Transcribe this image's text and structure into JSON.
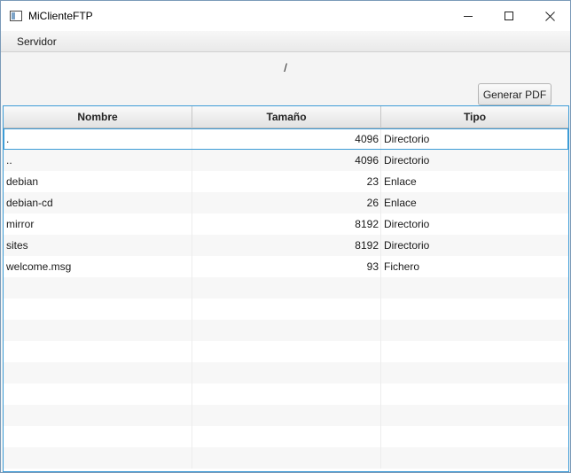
{
  "window": {
    "title": "MiClienteFTP"
  },
  "menu": {
    "items": [
      "Servidor"
    ]
  },
  "path": "/",
  "toolbar": {
    "pdf_label": "Generar PDF"
  },
  "table": {
    "columns": [
      "Nombre",
      "Tamaño",
      "Tipo"
    ],
    "rows": [
      {
        "name": ".",
        "size": "4096",
        "type": "Directorio"
      },
      {
        "name": "..",
        "size": "4096",
        "type": "Directorio"
      },
      {
        "name": "debian",
        "size": "23",
        "type": "Enlace"
      },
      {
        "name": "debian-cd",
        "size": "26",
        "type": "Enlace"
      },
      {
        "name": "mirror",
        "size": "8192",
        "type": "Directorio"
      },
      {
        "name": "sites",
        "size": "8192",
        "type": "Directorio"
      },
      {
        "name": "welcome.msg",
        "size": "93",
        "type": "Fichero"
      }
    ],
    "selected_row": 0
  },
  "colors": {
    "focus_border": "#3c9bd6",
    "stripe": "#f7f7f7"
  }
}
